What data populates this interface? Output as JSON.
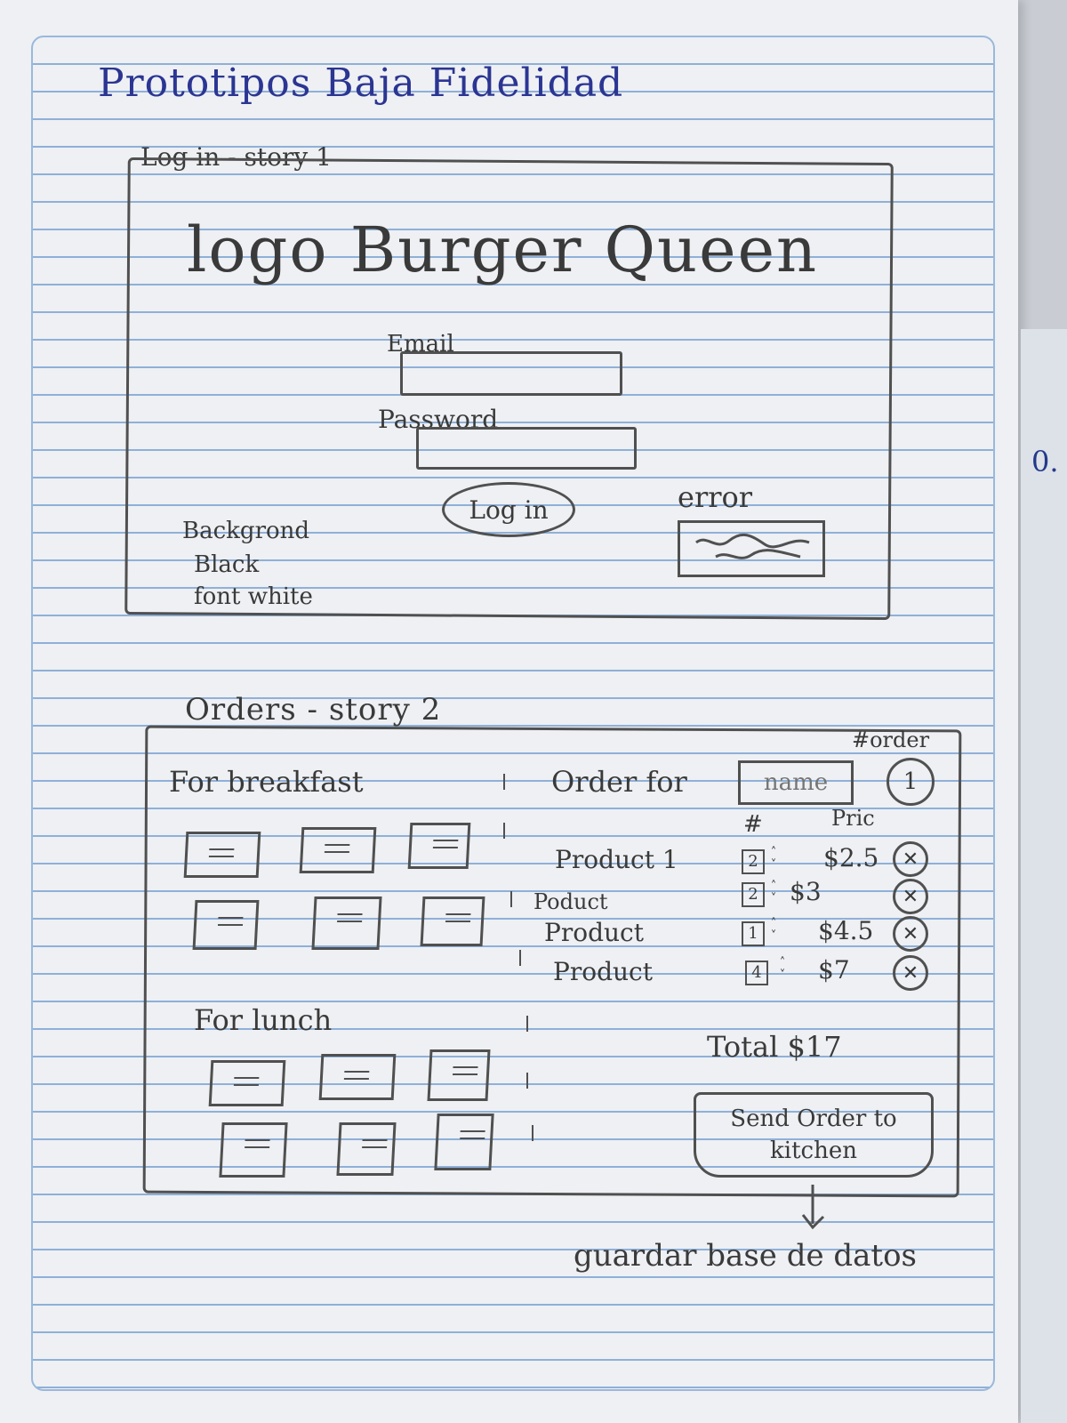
{
  "page": {
    "title": "Prototipos Baja Fidelidad",
    "side_text": "0."
  },
  "login": {
    "section_label": "Log in - story 1",
    "logo_text": "logo Burger Queen",
    "email_label": "Email",
    "password_label": "Password",
    "login_button": "Log in",
    "error_label": "error",
    "error_message": "~~~~",
    "notes": [
      "Backgrond",
      "Black",
      "font white"
    ]
  },
  "orders": {
    "section_label": "Orders - story 2",
    "order_number_label": "#order",
    "order_number": "1",
    "breakfast_label": "For breakfast",
    "lunch_label": "For lunch",
    "order_for_label": "Order for",
    "name_placeholder": "name",
    "qty_header": "#",
    "price_header": "Pric",
    "items": [
      {
        "name": "Product 1",
        "qty": "2",
        "price": "$2.5"
      },
      {
        "name": "Poduct",
        "qty": "2",
        "price": "$3"
      },
      {
        "name": "Product",
        "qty": "1",
        "price": "$4.5"
      },
      {
        "name": "Product",
        "qty": "4",
        "price": "$7"
      }
    ],
    "remove_symbol": "✕",
    "total_label": "Total $17",
    "send_button": "Send Order to kitchen",
    "save_note": "guardar base de datos"
  },
  "colors": {
    "pencil": "#505050",
    "pen": "#2b3592",
    "ruled_line": "#8fb0d8"
  }
}
